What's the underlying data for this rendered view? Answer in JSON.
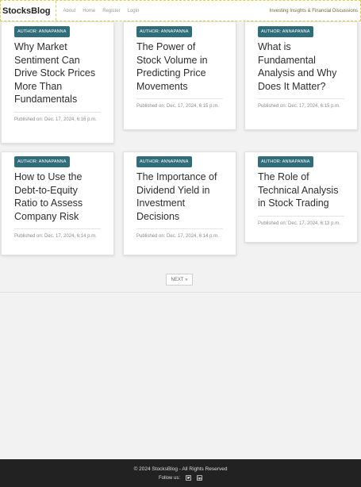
{
  "navbar": {
    "brand": "StocksBlog",
    "links": [
      "About",
      "Home",
      "Register",
      "Login"
    ],
    "tagline": "Investing Insights & Financial Discussions"
  },
  "posts": [
    {
      "author": "AUTHOR: ANNAPANNA",
      "title": "Why Market Sentiment Can Drive Stock Prices More Than Fundamentals",
      "date": "Published on: Dec. 17, 2024, 6:16 p.m."
    },
    {
      "author": "AUTHOR: ANNAPANNA",
      "title": "The Power of Stock Volume in Predicting Price Movements",
      "date": "Published on: Dec. 17, 2024, 6:15 p.m."
    },
    {
      "author": "AUTHOR: ANNAPANNA",
      "title": "What is Fundamental Analysis and Why Does It Matter?",
      "date": "Published on: Dec. 17, 2024, 6:15 p.m."
    },
    {
      "author": "AUTHOR: ANNAPANNA",
      "title": "How to Use the Debt-to-Equity Ratio to Assess Company Risk",
      "date": "Published on: Dec. 17, 2024, 6:14 p.m."
    },
    {
      "author": "AUTHOR: ANNAPANNA",
      "title": "The Importance of Dividend Yield in Investment Decisions",
      "date": "Published on: Dec. 17, 2024, 6:14 p.m."
    },
    {
      "author": "AUTHOR: ANNAPANNA",
      "title": "The Role of Technical Analysis in Stock Trading",
      "date": "Published on: Dec. 17, 2024, 6:13 p.m."
    }
  ],
  "pagination": {
    "next_label": "NEXT »"
  },
  "footer": {
    "copyright": "© 2024 StocksBlog - All Rights Reserved",
    "follow_label": "Follow us:",
    "icons": [
      "twitter-icon",
      "linkedin-icon"
    ]
  },
  "colors": {
    "badge": "#2f6d7a",
    "footer_bg": "#222222",
    "navbar_border": "#d8cf4a"
  }
}
